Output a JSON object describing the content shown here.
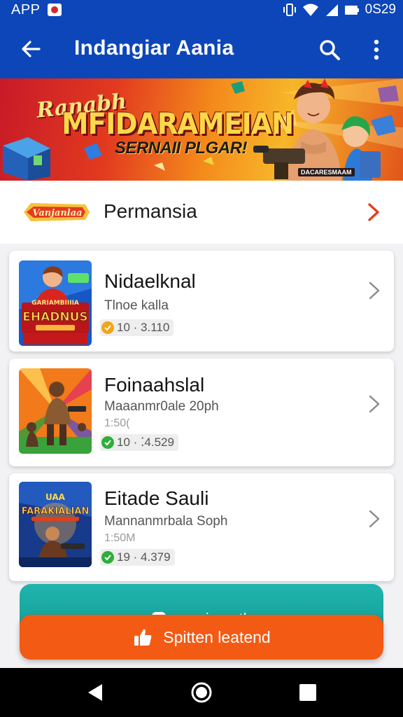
{
  "status_bar": {
    "app_label": "APP",
    "clock": "0S29",
    "icons": [
      "notification-icon",
      "vibrate-icon",
      "wifi-icon",
      "signal-icon",
      "battery-icon"
    ]
  },
  "app_bar": {
    "title": "Indangiar Aania",
    "icons": [
      "back-arrow-icon",
      "search-icon",
      "more-vert-icon"
    ]
  },
  "banner": {
    "small_text": "Ranabh",
    "big_text": "MFIDARAMEIAN",
    "subtitle": "SERNAII PLGAR!",
    "tag": "DACARESMAAM"
  },
  "section": {
    "logo_text": "Vanjanlaa",
    "label": "Permansia"
  },
  "cards": [
    {
      "name": "Nidaelknal",
      "subtitle": "Tlnoe kalla",
      "extra": "",
      "meta": "10 · 3.110",
      "thumb_title": "EHADNUS",
      "thumb_top": "GARIAMBIIIIA",
      "badge_color": "#f2a516"
    },
    {
      "name": "Foinaahslal",
      "subtitle": "Maaanmr0ale 20ph",
      "extra": "1:50(",
      "meta": "10 · ⁚4.529",
      "thumb_title": "",
      "thumb_top": "",
      "badge_color": "#2fae3a"
    },
    {
      "name": "Eitade Sauli",
      "subtitle": "Mannanmrbala Soph",
      "extra": "1:50M",
      "meta": "19 · 4.379",
      "thumb_title": "FARAKIALIAN",
      "thumb_top": "UAA",
      "badge_color": "#2fae3a"
    }
  ],
  "buttons": {
    "teal_label": "snanio nath",
    "orange_label": "Spitten leatend"
  },
  "colors": {
    "primary": "#0c46b9",
    "teal": "#1fb5ae",
    "orange": "#f35a14",
    "chevron_accent": "#e0401a"
  },
  "nav_bar": {
    "icons": [
      "back-triangle-icon",
      "home-circle-icon",
      "recents-square-icon"
    ]
  }
}
